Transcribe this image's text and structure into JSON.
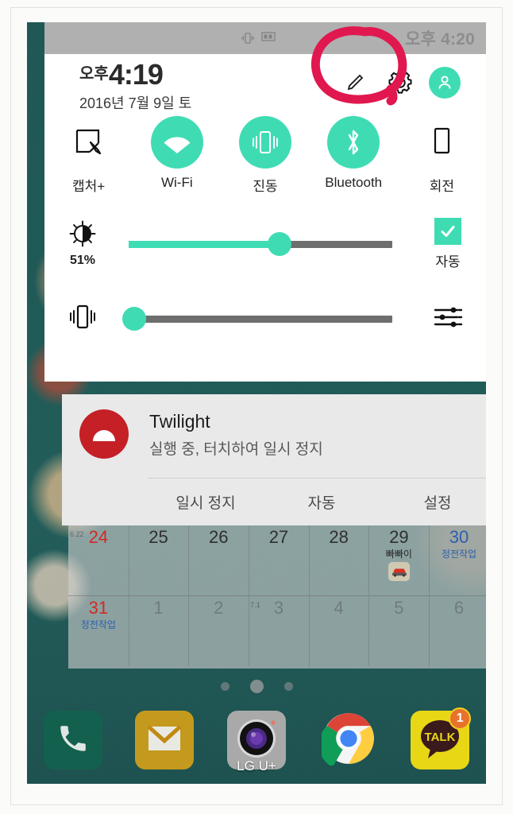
{
  "colors": {
    "accent_teal": "#3fdcb4",
    "annotation_red": "#e0184f",
    "panel_white": "#ffffff",
    "notification_grey": "#e9e9e9",
    "status_bar_grey": "#b0b0b0",
    "twilight_red": "#c42026",
    "wallpaper_teal": "#1f5a58"
  },
  "status_bar": {
    "time": "오후 4:20",
    "icons": [
      "vibrate-icon",
      "screenshot-icon"
    ]
  },
  "quick_settings": {
    "ampm": "오후",
    "clock": "4:19",
    "date": "2016년 7월 9일 토",
    "header_icons": [
      "edit-icon",
      "gear-icon",
      "profile-icon"
    ],
    "toggles": [
      {
        "label": "캡처+",
        "icon": "capture-plus-icon",
        "on": false
      },
      {
        "label": "Wi-Fi",
        "icon": "wifi-icon",
        "on": true
      },
      {
        "label": "진동",
        "icon": "vibrate-icon",
        "on": true
      },
      {
        "label": "Bluetooth",
        "icon": "bluetooth-icon",
        "on": true
      },
      {
        "label": "회전",
        "icon": "rotation-icon",
        "on": false
      }
    ],
    "brightness": {
      "icon": "brightness-icon",
      "value_label": "51%",
      "percent": 51,
      "auto_label": "자동",
      "auto_checked": true
    },
    "volume": {
      "icon": "vibrate-icon",
      "percent": 0,
      "settings_icon": "sound-settings-icon"
    }
  },
  "notification": {
    "app_icon": "twilight-icon",
    "title": "Twilight",
    "subtitle": "실행 중, 터치하여 일시 정지",
    "actions": [
      "일시 정지",
      "자동",
      "설정"
    ]
  },
  "calendar": {
    "rows": [
      [
        {
          "day": "24",
          "color": "red",
          "event": "",
          "tiny": "6.22"
        },
        {
          "day": "25",
          "color": "normal",
          "event": ""
        },
        {
          "day": "26",
          "color": "normal",
          "event": ""
        },
        {
          "day": "27",
          "color": "normal",
          "event": ""
        },
        {
          "day": "28",
          "color": "normal",
          "event": ""
        },
        {
          "day": "29",
          "color": "normal",
          "event": "빠빠이",
          "sticker": "car-icon"
        },
        {
          "day": "30",
          "color": "blue",
          "event": "정전작업",
          "event_color": "blue"
        }
      ],
      [
        {
          "day": "31",
          "color": "red",
          "event": "정전작업",
          "event_color": "blue"
        },
        {
          "day": "1",
          "color": "dim",
          "event": ""
        },
        {
          "day": "2",
          "color": "dim",
          "event": ""
        },
        {
          "day": "3",
          "color": "dim",
          "event": "",
          "tiny": "7.1"
        },
        {
          "day": "4",
          "color": "dim",
          "event": ""
        },
        {
          "day": "5",
          "color": "dim",
          "event": ""
        },
        {
          "day": "6",
          "color": "dim",
          "event": ""
        }
      ]
    ]
  },
  "home": {
    "page_dots": {
      "count": 3,
      "active_index": 1
    },
    "dock": [
      {
        "name": "phone-app",
        "label": "",
        "icon": "phone-icon"
      },
      {
        "name": "email-app",
        "label": "",
        "icon": "email-icon"
      },
      {
        "name": "camera-app",
        "label": "LG U+",
        "icon": "camera-icon"
      },
      {
        "name": "chrome-app",
        "label": "",
        "icon": "chrome-icon"
      },
      {
        "name": "kakaotalk-app",
        "label": "",
        "icon": "kakaotalk-icon",
        "badge": "1"
      }
    ]
  },
  "annotation": {
    "shape": "hand-drawn-circle",
    "target": "gear-icon"
  }
}
